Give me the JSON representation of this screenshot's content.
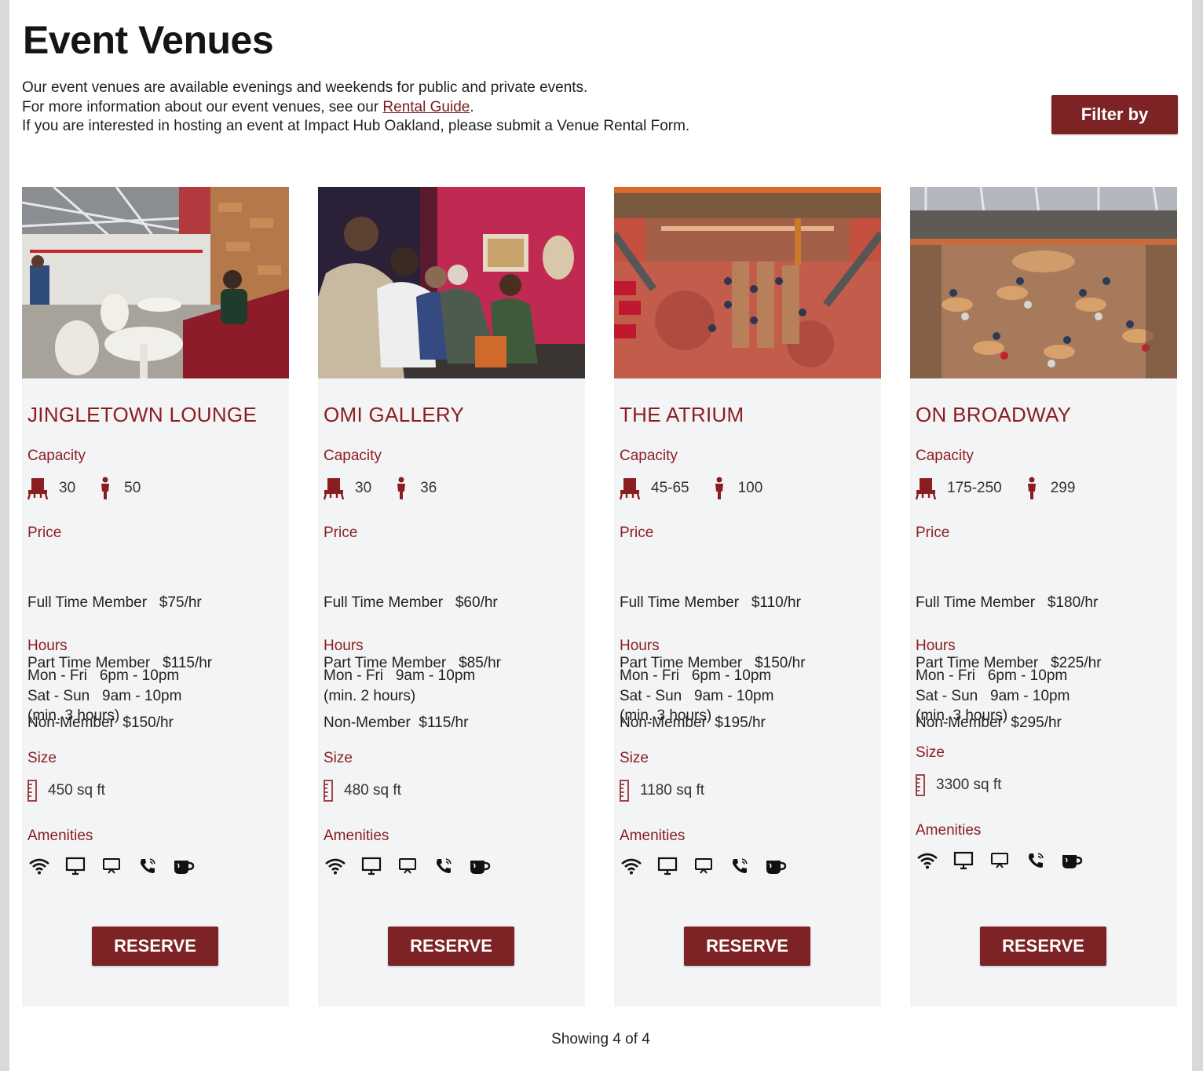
{
  "header": {
    "title": "Event Venues",
    "intro_line1": "Our event venues are available evenings and weekends for public and private events.",
    "intro_line2_prefix": "For more information about our event venues, see our ",
    "intro_link": "Rental Guide",
    "intro_line2_suffix": ".",
    "intro_line3": "If you are interested in hosting an event at Impact Hub Oakland, please submit a Venue Rental Form.",
    "filter_label": "Filter by"
  },
  "labels": {
    "capacity": "Capacity",
    "price": "Price",
    "hours": "Hours",
    "size": "Size",
    "amenities": "Amenities",
    "reserve": "RESERVE"
  },
  "amenity_icons": [
    "wifi-icon",
    "monitor-icon",
    "projector-icon",
    "phone-icon",
    "coffee-icon"
  ],
  "venues": [
    {
      "name": "JINGLETOWN LOUNGE",
      "seated": "30",
      "standing": "50",
      "price_full": "Full Time Member   $75/hr",
      "price_part": "Part Time Member   $115/hr",
      "price_non": "Non-Member  $150/hr",
      "hours": [
        "Mon - Fri   6pm - 10pm",
        "Sat - Sun   9am - 10pm",
        "(min. 3 hours)"
      ],
      "size": "450 sq ft"
    },
    {
      "name": "OMI GALLERY",
      "seated": "30",
      "standing": "36",
      "price_full": "Full Time Member   $60/hr",
      "price_part": "Part Time Member   $85/hr",
      "price_non": "Non-Member  $115/hr",
      "hours": [
        "Mon - Fri   9am - 10pm",
        "(min. 2 hours)",
        ""
      ],
      "size": "480 sq ft"
    },
    {
      "name": "THE ATRIUM",
      "seated": "45-65",
      "standing": "100",
      "price_full": "Full Time Member   $110/hr",
      "price_part": "Part Time Member   $150/hr",
      "price_non": "Non-Member  $195/hr",
      "hours": [
        "Mon - Fri   6pm - 10pm",
        "Sat - Sun   9am - 10pm",
        "(min. 3 hours)"
      ],
      "size": "1180 sq ft"
    },
    {
      "name": "ON BROADWAY",
      "seated": "175-250",
      "standing": "299",
      "price_full": "Full Time Member   $180/hr",
      "price_part": "Part Time Member   $225/hr",
      "price_non": "Non-Member  $295/hr",
      "hours": [
        "Mon - Fri   6pm - 10pm",
        "Sat - Sun   9am - 10pm",
        "(min. 3 hours)"
      ],
      "size": "3300 sq ft"
    }
  ],
  "footer": {
    "showing": "Showing 4 of 4"
  },
  "colors": {
    "accent": "#7d2325",
    "heading_red": "#8c1d1f",
    "card_bg": "#f3f4f5"
  }
}
